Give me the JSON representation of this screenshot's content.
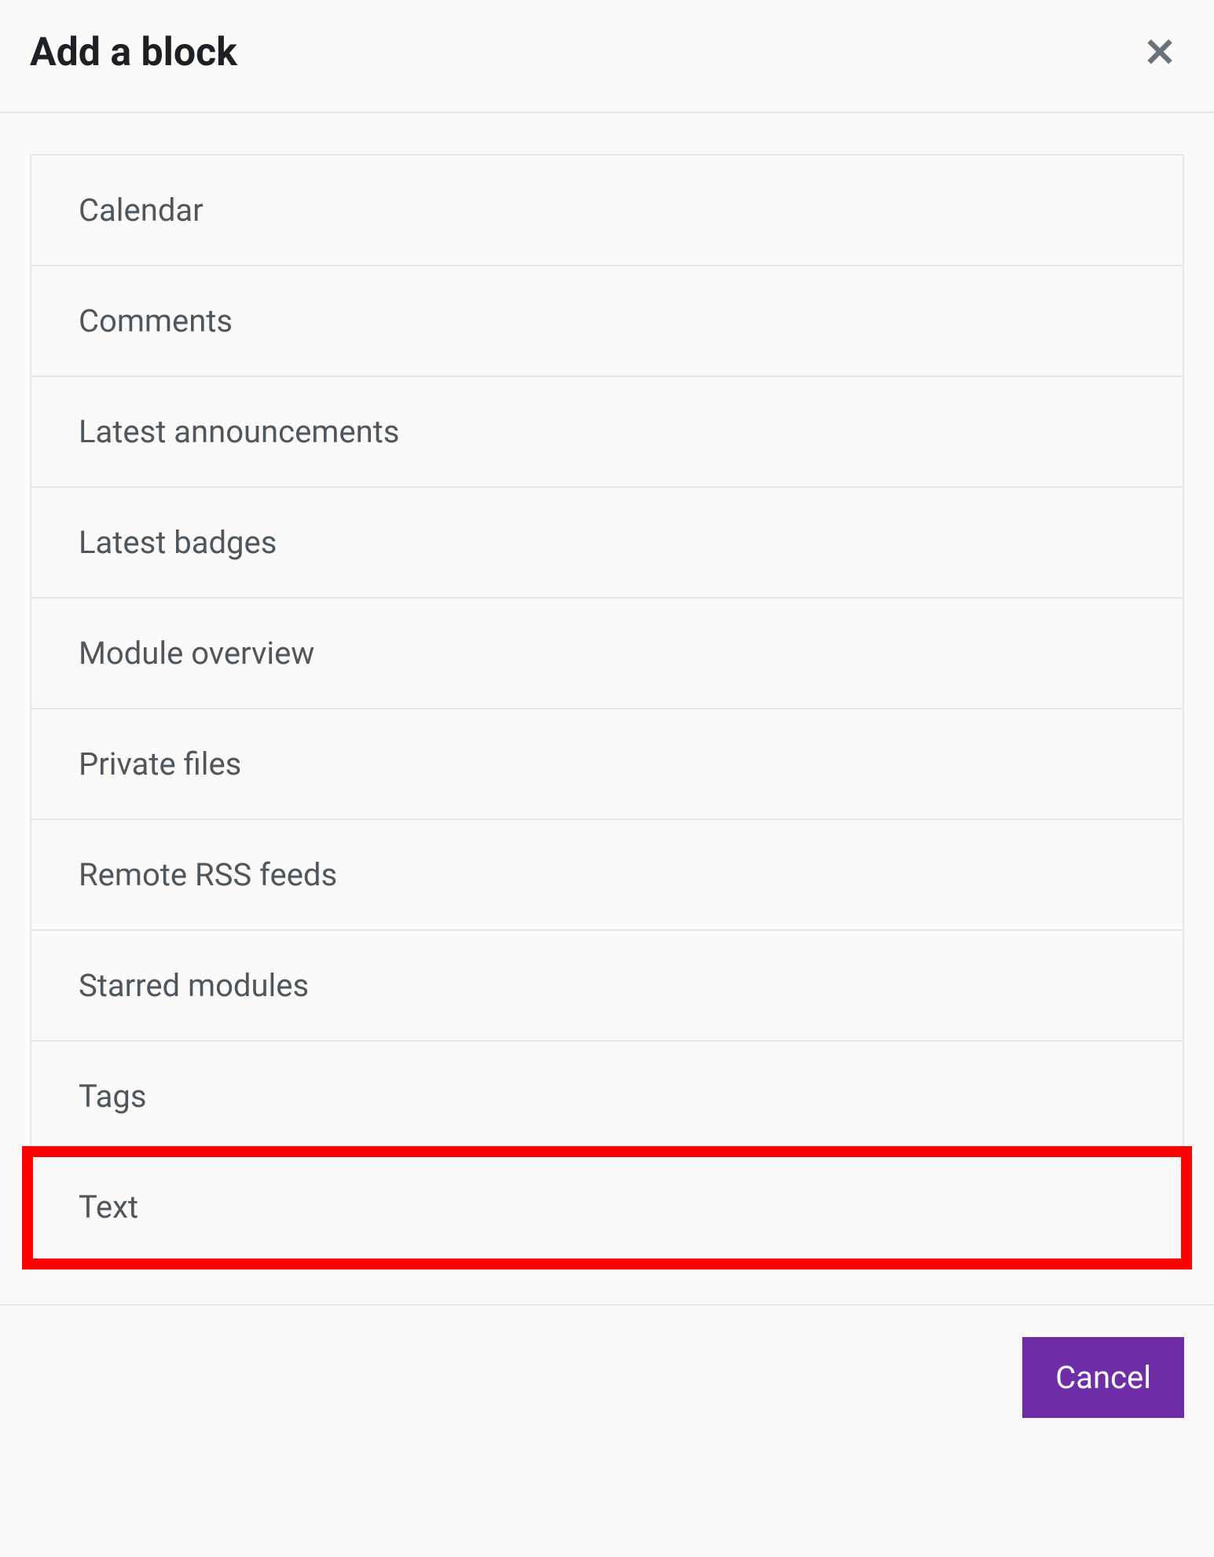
{
  "modal": {
    "title": "Add a block",
    "blocks": [
      {
        "label": "Calendar",
        "highlighted": false
      },
      {
        "label": "Comments",
        "highlighted": false
      },
      {
        "label": "Latest announcements",
        "highlighted": false
      },
      {
        "label": "Latest badges",
        "highlighted": false
      },
      {
        "label": "Module overview",
        "highlighted": false
      },
      {
        "label": "Private files",
        "highlighted": false
      },
      {
        "label": "Remote RSS feeds",
        "highlighted": false
      },
      {
        "label": "Starred modules",
        "highlighted": false
      },
      {
        "label": "Tags",
        "highlighted": false
      },
      {
        "label": "Text",
        "highlighted": true
      }
    ],
    "cancel_label": "Cancel"
  }
}
